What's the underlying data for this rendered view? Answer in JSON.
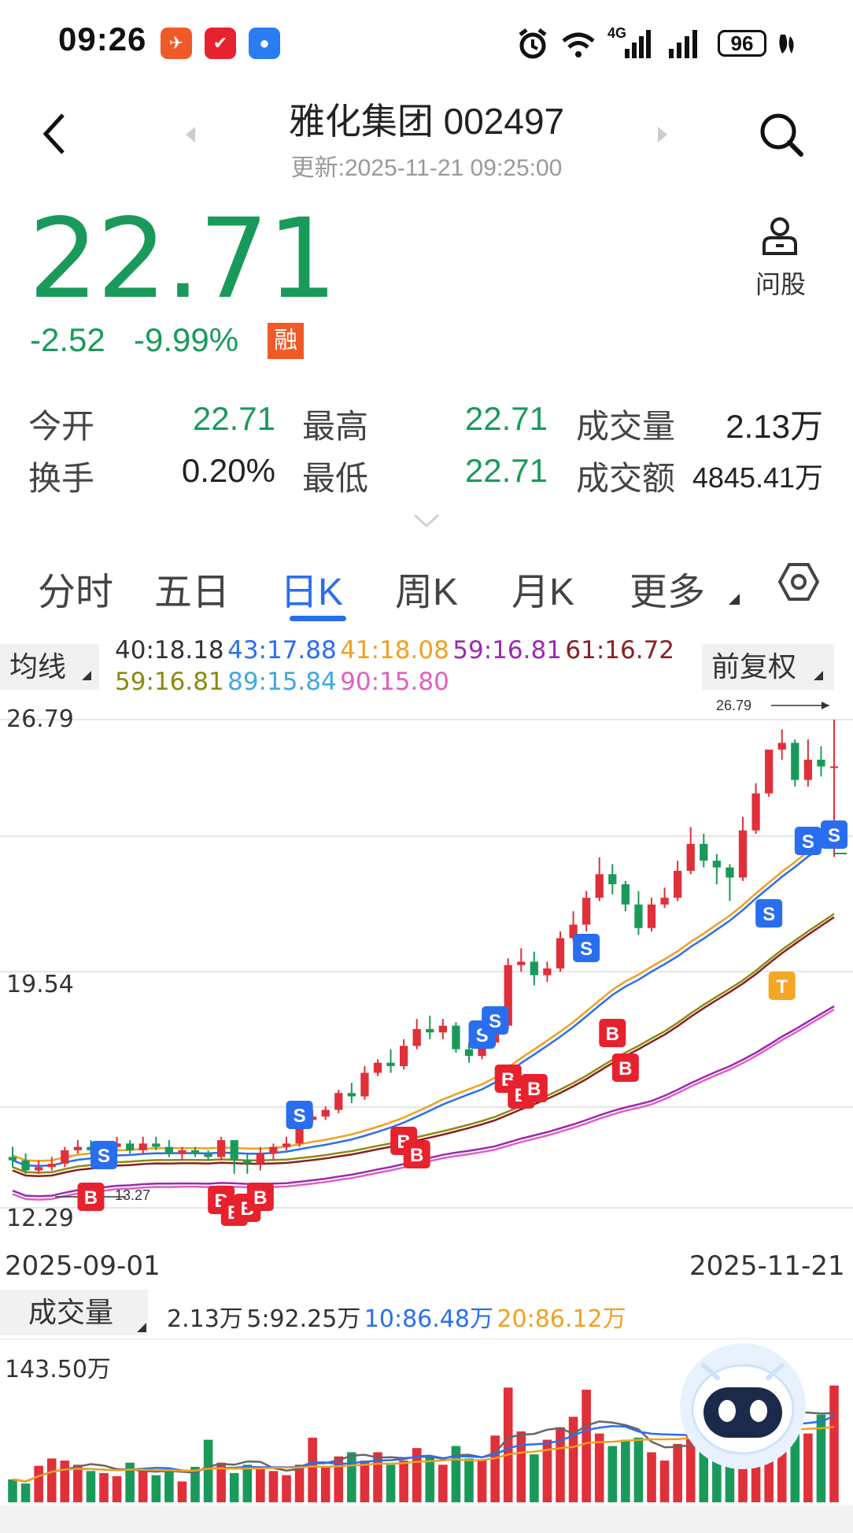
{
  "status_bar": {
    "time": "09:26",
    "battery": "96",
    "network": "4G"
  },
  "header": {
    "title": "雅化集团 002497",
    "updated": "更新:2025-11-21 09:25:00",
    "ask_label": "问股"
  },
  "quote": {
    "price": "22.71",
    "change": "-2.52",
    "change_pct": "-9.99%",
    "margin_badge": "融",
    "color_down": "#1a9a5a"
  },
  "stats": [
    {
      "label": "今开",
      "value": "22.71",
      "color": "green"
    },
    {
      "label": "最高",
      "value": "22.71",
      "color": "green"
    },
    {
      "label": "成交量",
      "value": "2.13万",
      "color": "dark"
    },
    {
      "label": "换手",
      "value": "0.20%",
      "color": "dark"
    },
    {
      "label": "最低",
      "value": "22.71",
      "color": "green"
    },
    {
      "label": "成交额",
      "value": "4845.41万",
      "color": "dark"
    }
  ],
  "tabs": [
    "分时",
    "五日",
    "日K",
    "周K",
    "月K",
    "更多"
  ],
  "active_tab": "日K",
  "ma": {
    "selector": "均线",
    "adjust": "前复权",
    "items": [
      {
        "text": "40:18.18",
        "color": "#333333"
      },
      {
        "text": "43:17.88",
        "color": "#2a6ef0"
      },
      {
        "text": "41:18.08",
        "color": "#f0a020"
      },
      {
        "text": "59:16.81",
        "color": "#9a2ab0"
      },
      {
        "text": "61:16.72",
        "color": "#8a2020"
      },
      {
        "text": "59:16.81",
        "color": "#8a8a10"
      },
      {
        "text": "89:15.84",
        "color": "#40a8e0"
      },
      {
        "text": "90:15.80",
        "color": "#e060c0"
      }
    ]
  },
  "kline": {
    "y_labels": [
      "26.79",
      "19.54",
      "12.29"
    ],
    "max_label": "26.79",
    "min_label": "13.27",
    "x_start": "2025-09-01",
    "x_end": "2025-11-21"
  },
  "volume": {
    "selector": "成交量",
    "items": [
      {
        "text": "2.13万",
        "color": "#333333"
      },
      {
        "text": "5:92.25万",
        "color": "#333333"
      },
      {
        "text": "10:86.48万",
        "color": "#2a6ef0"
      },
      {
        "text": "20:86.12万",
        "color": "#f0a020"
      }
    ],
    "max_label": "143.50万"
  },
  "chart_data": {
    "type": "candlestick",
    "y_range": [
      12.29,
      26.79
    ],
    "dates": [
      "2025-09-01",
      "2025-11-21"
    ],
    "candles": [
      [
        13.8,
        13.7,
        14.1,
        13.5
      ],
      [
        13.7,
        13.4,
        13.9,
        13.3
      ],
      [
        13.4,
        13.5,
        13.7,
        13.3
      ],
      [
        13.5,
        13.6,
        13.8,
        13.4
      ],
      [
        13.6,
        14.0,
        14.1,
        13.5
      ],
      [
        14.0,
        14.1,
        14.3,
        13.9
      ],
      [
        14.1,
        14.0,
        14.3,
        13.9
      ],
      [
        14.0,
        14.1,
        14.2,
        13.9
      ],
      [
        14.1,
        14.2,
        14.4,
        14.0
      ],
      [
        14.2,
        14.0,
        14.3,
        13.9
      ],
      [
        14.0,
        14.2,
        14.4,
        13.9
      ],
      [
        14.2,
        14.1,
        14.4,
        14.0
      ],
      [
        14.1,
        13.9,
        14.3,
        13.8
      ],
      [
        13.9,
        14.0,
        14.1,
        13.7
      ],
      [
        14.0,
        13.9,
        14.1,
        13.8
      ],
      [
        13.9,
        13.8,
        14.0,
        13.7
      ],
      [
        13.8,
        14.3,
        14.4,
        13.7
      ],
      [
        14.3,
        13.7,
        14.3,
        13.3
      ],
      [
        13.7,
        13.6,
        13.9,
        13.3
      ],
      [
        13.6,
        13.9,
        14.1,
        13.4
      ],
      [
        13.9,
        14.1,
        14.2,
        13.7
      ],
      [
        14.1,
        14.2,
        14.4,
        14.0
      ],
      [
        14.2,
        14.9,
        15.0,
        14.1
      ],
      [
        14.9,
        15.0,
        15.2,
        14.8
      ],
      [
        15.0,
        15.2,
        15.3,
        14.9
      ],
      [
        15.2,
        15.7,
        15.8,
        15.1
      ],
      [
        15.7,
        15.6,
        16.0,
        15.4
      ],
      [
        15.6,
        16.3,
        16.5,
        15.5
      ],
      [
        16.3,
        16.6,
        16.7,
        16.2
      ],
      [
        16.6,
        16.5,
        17.0,
        16.3
      ],
      [
        16.5,
        17.1,
        17.3,
        16.4
      ],
      [
        17.1,
        17.6,
        17.9,
        17.0
      ],
      [
        17.6,
        17.5,
        18.0,
        17.3
      ],
      [
        17.5,
        17.7,
        17.9,
        17.3
      ],
      [
        17.7,
        17.0,
        17.8,
        16.9
      ],
      [
        17.0,
        16.8,
        17.2,
        16.6
      ],
      [
        16.8,
        17.2,
        17.3,
        16.7
      ],
      [
        17.2,
        17.7,
        17.9,
        17.1
      ],
      [
        17.7,
        19.5,
        19.7,
        17.6
      ],
      [
        19.5,
        19.6,
        20.0,
        19.3
      ],
      [
        19.6,
        19.2,
        19.9,
        18.9
      ],
      [
        19.2,
        19.4,
        19.6,
        19.0
      ],
      [
        19.4,
        20.3,
        20.5,
        19.3
      ],
      [
        20.3,
        20.7,
        21.1,
        20.2
      ],
      [
        20.7,
        21.5,
        21.7,
        20.5
      ],
      [
        21.5,
        22.2,
        22.7,
        21.4
      ],
      [
        22.2,
        21.9,
        22.5,
        21.6
      ],
      [
        21.9,
        21.3,
        22.0,
        21.1
      ],
      [
        21.3,
        20.6,
        21.7,
        20.4
      ],
      [
        20.6,
        21.3,
        21.5,
        20.5
      ],
      [
        21.3,
        21.5,
        21.8,
        21.2
      ],
      [
        21.5,
        22.3,
        22.6,
        21.4
      ],
      [
        22.3,
        23.1,
        23.6,
        22.2
      ],
      [
        23.1,
        22.6,
        23.4,
        22.4
      ],
      [
        22.6,
        22.4,
        22.8,
        21.9
      ],
      [
        22.4,
        22.1,
        22.5,
        21.4
      ],
      [
        22.1,
        23.5,
        23.9,
        22.0
      ],
      [
        23.5,
        24.6,
        24.9,
        23.4
      ],
      [
        24.6,
        25.9,
        25.5,
        24.5
      ],
      [
        25.9,
        26.1,
        26.5,
        25.6
      ],
      [
        26.1,
        25.0,
        26.2,
        24.8
      ],
      [
        25.0,
        25.6,
        26.2,
        24.8
      ],
      [
        25.6,
        25.4,
        26.0,
        25.1
      ],
      [
        25.4,
        25.4,
        26.79,
        22.71
      ]
    ],
    "volume_max": 143.5,
    "volume_unit": "万"
  }
}
